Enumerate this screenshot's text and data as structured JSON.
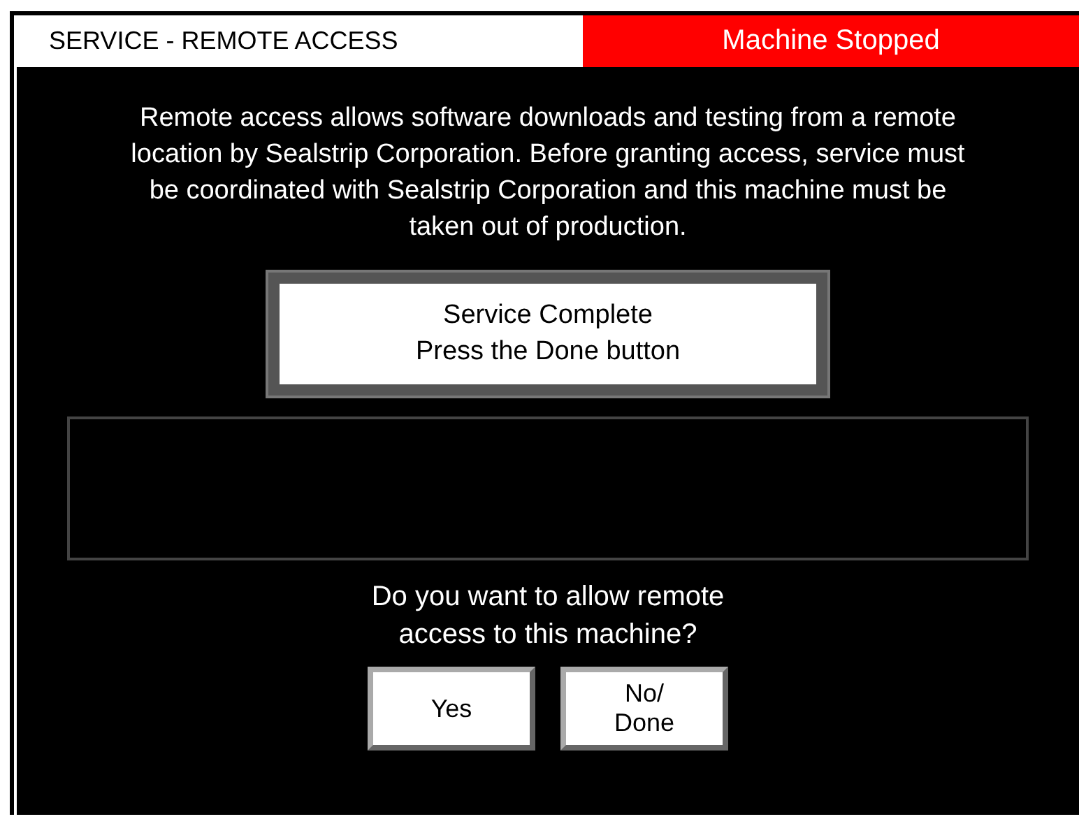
{
  "header": {
    "title": "SERVICE - REMOTE ACCESS",
    "status": "Machine Stopped",
    "stopped": true
  },
  "description": "Remote access allows software downloads and testing from a remote location by Sealstrip Corporation. Before granting access, service must be coordinated with Sealstrip Corporation and this machine must be taken out of production.",
  "status_button": {
    "lines": [
      "Service Complete",
      "Press the Done button"
    ]
  },
  "question": [
    "Do you want to allow remote",
    "access to this machine?"
  ],
  "buttons": [
    {
      "lines": [
        "Yes"
      ]
    },
    {
      "lines": [
        "No/",
        "Done"
      ]
    }
  ]
}
